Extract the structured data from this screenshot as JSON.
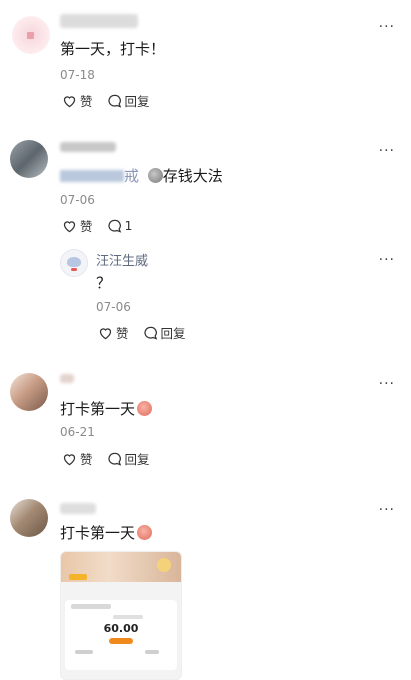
{
  "comments": [
    {
      "text": "第一天，打卡！",
      "date": "07-18",
      "like_label": "赞",
      "reply_label": "回复"
    },
    {
      "text_suffix": "戒",
      "sticker_text": "存钱大法",
      "date": "07-06",
      "like_label": "赞",
      "reply_count": "1",
      "reply": {
        "name": "汪汪生威",
        "text": "？",
        "date": "07-06",
        "like_label": "赞",
        "reply_label": "回复"
      }
    },
    {
      "text": "打卡第一天",
      "date": "06-21",
      "like_label": "赞",
      "reply_label": "回复"
    },
    {
      "text": "打卡第一天",
      "image": {
        "amount": "60.00"
      }
    }
  ],
  "more_label": "···",
  "colors": {
    "accent_orange": "#f08a1c",
    "muted": "#8a8a8a",
    "name_blue": "#606a80"
  }
}
